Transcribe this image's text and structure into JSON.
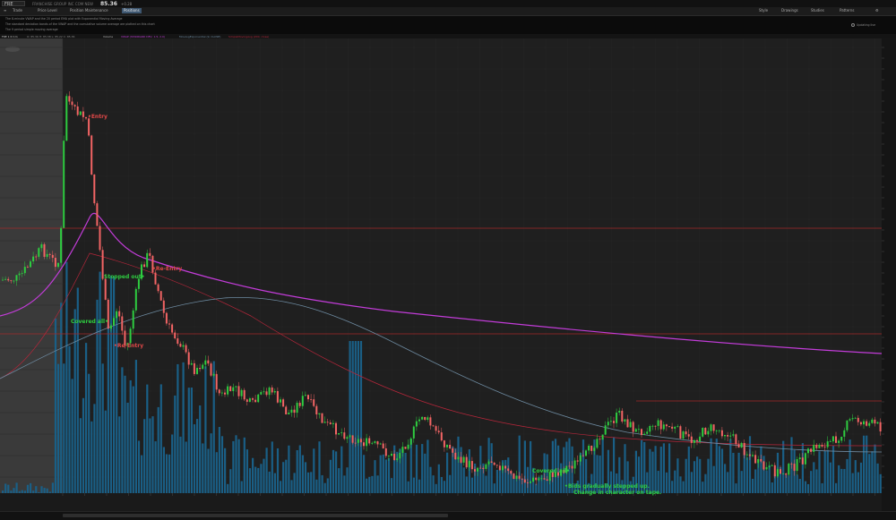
{
  "symbol": {
    "ticker": "FRE",
    "description": "FRANCHISE GROUP INC COM NEW",
    "price": "85.36",
    "change": "+0.28"
  },
  "toolbar": {
    "items": [
      {
        "label": "Trade"
      },
      {
        "label": "Price Level"
      },
      {
        "label": "Position Maintenance"
      },
      {
        "label": "Positions"
      }
    ],
    "right_items": [
      {
        "label": "Style"
      },
      {
        "label": "Drawings"
      },
      {
        "label": "Studies"
      },
      {
        "label": "Patterns"
      }
    ]
  },
  "study_description": {
    "line1": "The 8-minute VWAP and the 20 period EMA plot with Exponential Moving Average",
    "line2": "The standard deviation bands of the VWAP and the cumulative volume average are plotted on this chart",
    "line3": "The 9 period simple moving average"
  },
  "updating_label": "Updating live",
  "studies_bar": {
    "timeframe": "FRE 1 D 1m",
    "ohlc": "O: 85.36  H: 85.38  L: 85.22  C: 85.36",
    "volume_label": "Volume",
    "vwap_label": "VWAP (STANDARD DEV, 1.5, 2.0)",
    "ema_label": "MovAvgExponential (9, CLOSE)",
    "sma_label": "SimpleMovingAvg (200, close)"
  },
  "annotations": [
    {
      "text": "•Entry",
      "color": "#e04848"
    },
    {
      "text": "Stopped out•",
      "color": "#2ecc40"
    },
    {
      "text": "•Re-Entry",
      "color": "#e04848"
    },
    {
      "text": "Covered all•",
      "color": "#2ecc40"
    },
    {
      "text": "•Re-Entry",
      "color": "#e04848"
    },
    {
      "text": "Covered all•",
      "color": "#2ecc40"
    },
    {
      "text": "•Bids gradually stepped up.",
      "color": "#2ecc40"
    },
    {
      "text": "Change in character on tape.",
      "color": "#2ecc40"
    }
  ],
  "colors": {
    "up_candle": "#2ecc40",
    "down_candle": "#f26464",
    "volume": "#1a5f86",
    "vwap": "#c23cd8",
    "ema": "#b5263a",
    "sma": "#6d8aa0",
    "level": "#a22a2a",
    "premarket_shade": "#3a3a3a"
  }
}
